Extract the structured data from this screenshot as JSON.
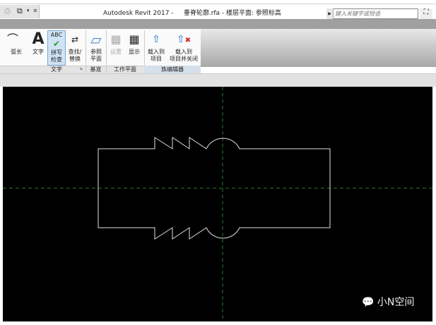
{
  "window": {
    "title": "Autodesk Revit 2017 -     垂脊轮廓.rfa - 楼层平面: 参照标高"
  },
  "search": {
    "placeholder": "键入关键字或短语"
  },
  "ribbon": {
    "tools": [
      {
        "label": "弧长",
        "icon": "arc-length-icon"
      },
      {
        "label": "文字",
        "icon": "text-icon"
      },
      {
        "label": "拼写\n检查",
        "icon": "spell-check-icon"
      },
      {
        "label": "查找/\n替换",
        "icon": "find-replace-icon"
      },
      {
        "label": "参照\n平面",
        "icon": "reference-plane-icon"
      },
      {
        "label": "设置",
        "icon": "workplane-set-icon"
      },
      {
        "label": "显示",
        "icon": "workplane-show-icon"
      },
      {
        "label": "载入到\n项目",
        "icon": "load-into-project-icon"
      },
      {
        "label": "载入到\n项目并关闭",
        "icon": "load-and-close-icon"
      }
    ],
    "panels": [
      "文字",
      "基准",
      "工作平面",
      "族编辑器"
    ]
  },
  "watermark": {
    "text": "小N空间"
  },
  "colors": {
    "canvas": "#000000",
    "lines": "#e0e0e0",
    "refplanes": "#2e7d32"
  }
}
